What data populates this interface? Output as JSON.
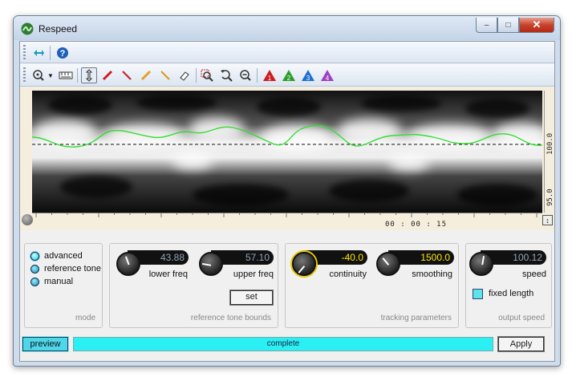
{
  "window": {
    "title": "Respeed",
    "icon": "respeed-logo-icon",
    "controls": [
      "minimize-icon",
      "maximize-icon",
      "close-icon"
    ]
  },
  "toolbar1": {
    "items": [
      "pin-icon",
      "help-icon"
    ]
  },
  "toolbar2": {
    "items": [
      "zoom-menu-icon",
      "ruler-icon",
      "hand-scroll-icon",
      "pencil-red-icon",
      "line-red-icon",
      "pencil-orange-icon",
      "line-orange-icon",
      "eraser-icon",
      "zoom-selection-icon",
      "zoom-reset-icon",
      "zoom-out-icon",
      "marker-1-icon",
      "marker-2-icon",
      "marker-3-icon",
      "marker-4-icon"
    ],
    "markers": [
      "1",
      "2",
      "3",
      "4"
    ]
  },
  "spectrogram": {
    "right_axis_labels": [
      "100.0",
      "95.0"
    ],
    "time_label": "00 : 00 : 15"
  },
  "mode": {
    "options": [
      "advanced",
      "reference tone",
      "manual"
    ],
    "selected": "advanced",
    "label": "mode"
  },
  "reference_tone_bounds": {
    "lower_freq_value": "43.88",
    "lower_freq_label": "lower freq",
    "upper_freq_value": "57.10",
    "upper_freq_label": "upper freq",
    "set_label": "set",
    "label": "reference tone bounds"
  },
  "tracking_parameters": {
    "continuity_value": "-40.0",
    "continuity_label": "continuity",
    "smoothing_value": "1500.0",
    "smoothing_label": "smoothing",
    "label": "tracking parameters"
  },
  "output_speed": {
    "speed_value": "100.12",
    "speed_label": "speed",
    "fixed_length_label": "fixed length",
    "fixed_length_checked": true,
    "label": "output speed"
  },
  "bottom": {
    "preview_label": "preview",
    "status": "complete",
    "apply_label": "Apply"
  },
  "colors": {
    "accent": "#4ed6ea",
    "progress": "#2af0f4",
    "track_line": "#33dd33",
    "yellow_value": "#ffe800"
  }
}
